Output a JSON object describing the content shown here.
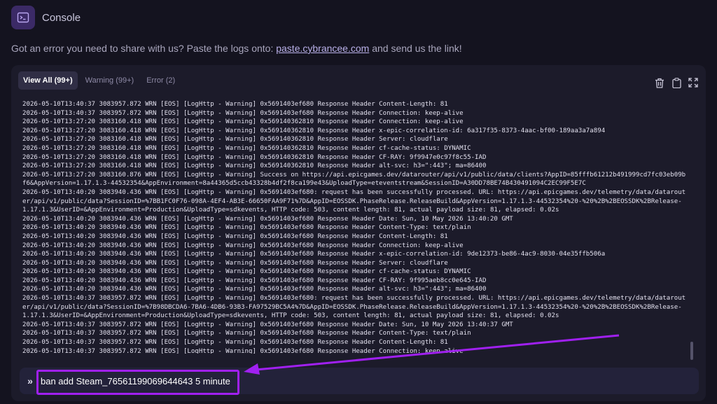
{
  "header": {
    "title": "Console",
    "icon": "terminal-icon"
  },
  "intro": {
    "text_before": "Got an error you need to share with us? Paste the logs onto: ",
    "link_text": "paste.cybrancee.com",
    "text_after": " and send us the link!"
  },
  "tabs": [
    {
      "label": "View All (99+)",
      "active": true
    },
    {
      "label": "Warning (99+)",
      "active": false
    },
    {
      "label": "Error (2)",
      "active": false
    }
  ],
  "tools": [
    "trash-icon",
    "clipboard-icon",
    "expand-icon"
  ],
  "log_lines": [
    "2026-05-10T13:40:37 3083957.872 WRN [EOS] [LogHttp - Warning] 0x5691403ef680 Response Header Content-Length: 81",
    "2026-05-10T13:40:37 3083957.872 WRN [EOS] [LogHttp - Warning] 0x5691403ef680 Response Header Connection: keep-alive",
    "2026-05-10T13:27:20 3083160.418 WRN [EOS] [LogHttp - Warning] 0x569140362810 Response Header Connection: keep-alive",
    "2026-05-10T13:27:20 3083160.418 WRN [EOS] [LogHttp - Warning] 0x569140362810 Response Header x-epic-correlation-id: 6a317f35-8373-4aac-bf00-189aa3a7a894",
    "2026-05-10T13:27:20 3083160.418 WRN [EOS] [LogHttp - Warning] 0x569140362810 Response Header Server: cloudflare",
    "2026-05-10T13:27:20 3083160.418 WRN [EOS] [LogHttp - Warning] 0x569140362810 Response Header cf-cache-status: DYNAMIC",
    "2026-05-10T13:27:20 3083160.418 WRN [EOS] [LogHttp - Warning] 0x569140362810 Response Header CF-RAY: 9f9947e0c97f8c55-IAD",
    "2026-05-10T13:27:20 3083160.418 WRN [EOS] [LogHttp - Warning] 0x569140362810 Response Header alt-svc: h3=\":443\"; ma=86400",
    "2026-05-10T13:27:20 3083160.876 WRN [EOS] [LogHttp - Warning] Success on https://api.epicgames.dev/datarouter/api/v1/public/data/clients?AppID=85fffb61212b491999cd7fc03eb09bf6&AppVersion=1.17.1.3-44532354&AppEnvironment=8a44365d5ccb43328b4df2f8ca199e43&UploadType=eteventstream&SessionID=A30DD78BE74B430491094C2EC99F5E7C",
    "2026-05-10T13:40:20 3083940.436 WRN [EOS] [LogHttp - Warning] 0x5691403ef680: request has been successfully processed. URL: https://api.epicgames.dev/telemetry/data/datarouter/api/v1/public/data?SessionID=%7BB1FC0F76-098A-4EF4-AB3E-66650FAA9F71%7D&AppID=EOSSDK.PhaseRelease.ReleaseBuild&AppVersion=1.17.1.3-44532354%20-%20%2B%2BEOSSDK%2BRelease-1.17.1.3&UserID=&AppEnvironment=Production&UploadType=sdkevents, HTTP code: 503, content length: 81, actual payload size: 81, elapsed: 0.02s",
    "2026-05-10T13:40:20 3083940.436 WRN [EOS] [LogHttp - Warning] 0x5691403ef680 Response Header Date: Sun, 10 May 2026 13:40:20 GMT",
    "2026-05-10T13:40:20 3083940.436 WRN [EOS] [LogHttp - Warning] 0x5691403ef680 Response Header Content-Type: text/plain",
    "2026-05-10T13:40:20 3083940.436 WRN [EOS] [LogHttp - Warning] 0x5691403ef680 Response Header Content-Length: 81",
    "2026-05-10T13:40:20 3083940.436 WRN [EOS] [LogHttp - Warning] 0x5691403ef680 Response Header Connection: keep-alive",
    "2026-05-10T13:40:20 3083940.436 WRN [EOS] [LogHttp - Warning] 0x5691403ef680 Response Header x-epic-correlation-id: 9de12373-be86-4ac9-8030-04e35ffb506a",
    "2026-05-10T13:40:20 3083940.436 WRN [EOS] [LogHttp - Warning] 0x5691403ef680 Response Header Server: cloudflare",
    "2026-05-10T13:40:20 3083940.436 WRN [EOS] [LogHttp - Warning] 0x5691403ef680 Response Header cf-cache-status: DYNAMIC",
    "2026-05-10T13:40:20 3083940.436 WRN [EOS] [LogHttp - Warning] 0x5691403ef680 Response Header CF-RAY: 9f995aeb8cc0e645-IAD",
    "2026-05-10T13:40:20 3083940.436 WRN [EOS] [LogHttp - Warning] 0x5691403ef680 Response Header alt-svc: h3=\":443\"; ma=86400",
    "2026-05-10T13:40:37 3083957.872 WRN [EOS] [LogHttp - Warning] 0x5691403ef680: request has been successfully processed. URL: https://api.epicgames.dev/telemetry/data/datarouter/api/v1/public/data?SessionID=%7B98DBCDA6-7BA6-4DB6-93B3-FA97529BC5A4%7D&AppID=EOSSDK.PhaseRelease.ReleaseBuild&AppVersion=1.17.1.3-44532354%20-%20%2B%2BEOSSDK%2BRelease-1.17.1.3&UserID=&AppEnvironment=Production&UploadType=sdkevents, HTTP code: 503, content length: 81, actual payload size: 81, elapsed: 0.02s",
    "2026-05-10T13:40:37 3083957.872 WRN [EOS] [LogHttp - Warning] 0x5691403ef680 Response Header Date: Sun, 10 May 2026 13:40:37 GMT",
    "2026-05-10T13:40:37 3083957.872 WRN [EOS] [LogHttp - Warning] 0x5691403ef680 Response Header Content-Type: text/plain",
    "2026-05-10T13:40:37 3083957.872 WRN [EOS] [LogHttp - Warning] 0x5691403ef680 Response Header Content-Length: 81",
    "2026-05-10T13:40:37 3083957.872 WRN [EOS] [LogHttp - Warning] 0x5691403ef680 Response Header Connection: keep-alive"
  ],
  "command": {
    "prompt": "»",
    "value": "ban add Steam_76561199069644643 5 minute"
  },
  "colors": {
    "background": "#14131f",
    "panel": "#1c1b2a",
    "accent": "#a020f0",
    "tab_active": "#302e45"
  }
}
